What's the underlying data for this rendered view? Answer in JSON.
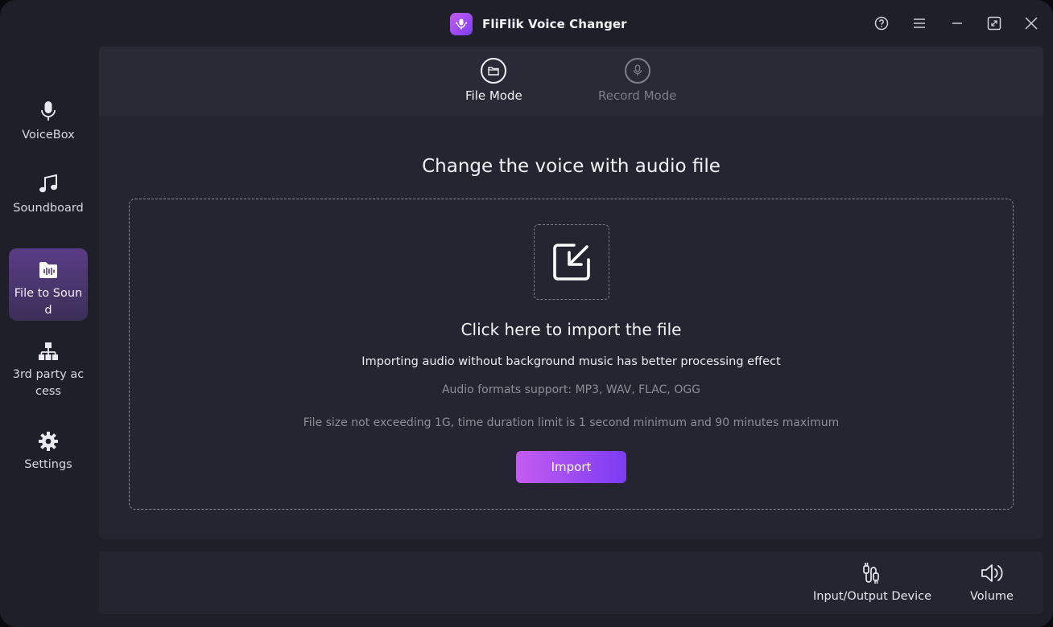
{
  "app": {
    "title": "FliFlik Voice Changer",
    "accent": "#a04cf3"
  },
  "sidebar": {
    "items": [
      {
        "label": "VoiceBox",
        "icon": "microphone-icon",
        "active": false
      },
      {
        "label": "Soundboard",
        "icon": "music-note-icon",
        "active": false
      },
      {
        "label": "File to Sound",
        "icon": "audio-file-icon",
        "active": true
      },
      {
        "label": "3rd party access",
        "icon": "network-icon",
        "active": false
      },
      {
        "label": "Settings",
        "icon": "gear-icon",
        "active": false
      }
    ]
  },
  "modes": {
    "tabs": [
      {
        "label": "File Mode",
        "icon": "folder-icon",
        "active": true
      },
      {
        "label": "Record Mode",
        "icon": "microphone-icon",
        "active": false
      }
    ]
  },
  "main": {
    "title": "Change the voice with audio file",
    "dropzone": {
      "headline": "Click here to import the file",
      "hint": "Importing  audio without background music has better processing effect",
      "formats": "Audio formats support: MP3, WAV, FLAC, OGG",
      "limit": "File size not exceeding 1G, time duration limit is 1 second minimum and 90 minutes maximum",
      "import_label": "Import"
    }
  },
  "bottom": {
    "io_label": "Input/Output Device",
    "volume_label": "Volume"
  }
}
